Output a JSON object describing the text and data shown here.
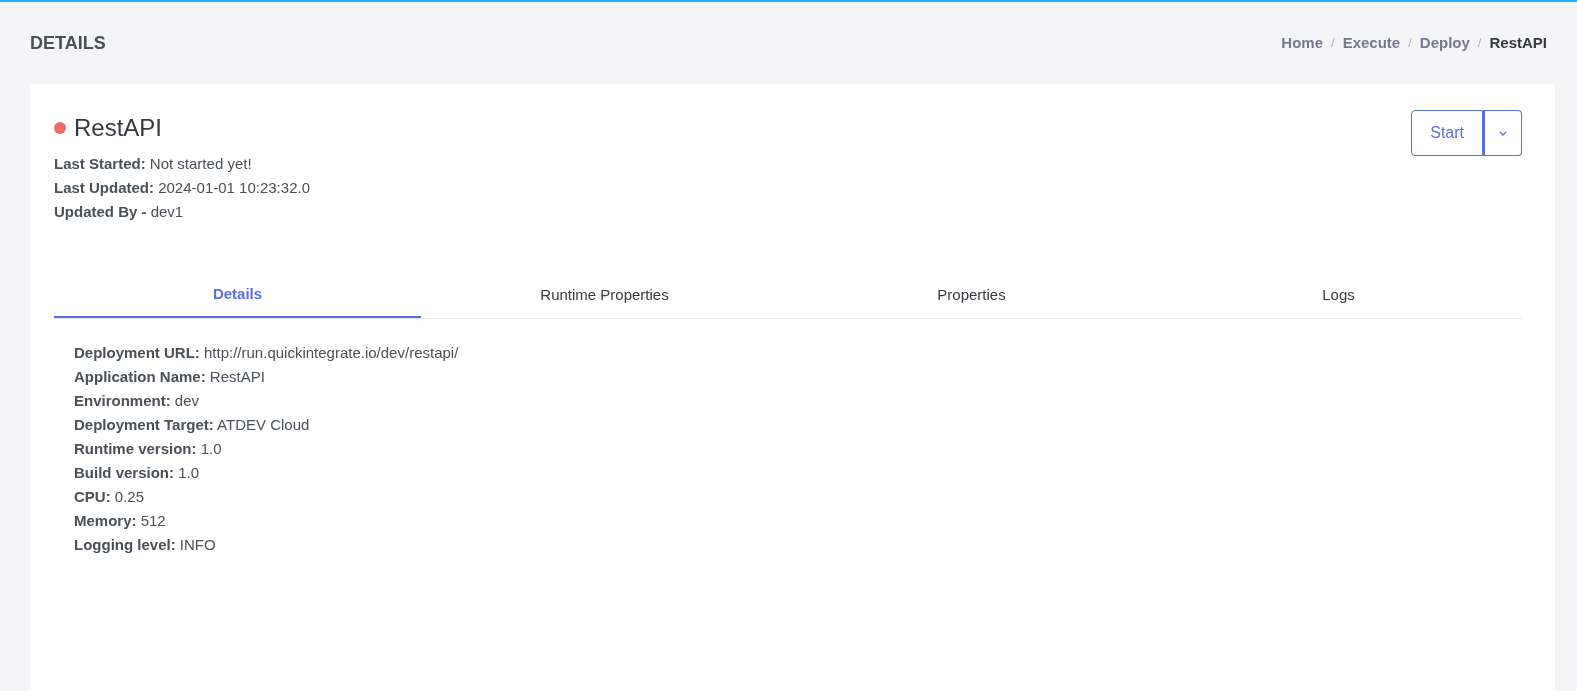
{
  "page_title": "DETAILS",
  "breadcrumb": [
    {
      "label": "Home",
      "current": false
    },
    {
      "label": "Execute",
      "current": false
    },
    {
      "label": "Deploy",
      "current": false
    },
    {
      "label": "RestAPI",
      "current": true
    }
  ],
  "breadcrumb_separator": "/",
  "app": {
    "name": "RestAPI",
    "color": "#f06a6a"
  },
  "meta": [
    "**Last Started:** Not started yet!",
    "**Last Updated:** 2024-01-01 10:23:32.0",
    "**Updated By -** dev1"
  ],
  "start_button": {
    "label": "Start"
  },
  "tabs": [
    {
      "label": "Details",
      "selected": true
    },
    {
      "label": "Runtime Properties",
      "selected": false
    },
    {
      "label": "Properties",
      "selected": false
    },
    {
      "label": "Logs",
      "selected": false
    }
  ],
  "details": [
    "**Deployment URL:** http://run.quickintegrate.io/dev/restapi/",
    "**Application Name:** RestAPI",
    "**Environment:** dev",
    "**Deployment Target:** ATDEV Cloud",
    "**Runtime version:** 1.0",
    "**Build version:** 1.0",
    "**CPU:** 0.25",
    "**Memory:** 512",
    "**Logging level:** INFO"
  ]
}
